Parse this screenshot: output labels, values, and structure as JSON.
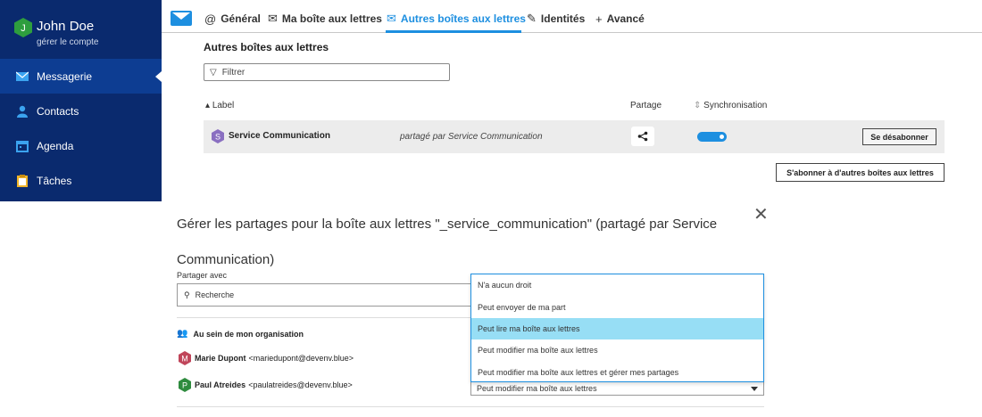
{
  "user": {
    "initial": "J",
    "name": "John Doe",
    "manage_label": "gérer le compte"
  },
  "sidebar": {
    "items": [
      {
        "label": "Messagerie",
        "icon": "mail-icon",
        "active": true
      },
      {
        "label": "Contacts",
        "icon": "person-icon"
      },
      {
        "label": "Agenda",
        "icon": "calendar-icon"
      },
      {
        "label": "Tâches",
        "icon": "clipboard-icon"
      }
    ]
  },
  "tabs": [
    {
      "label": "Général",
      "icon": "at-icon"
    },
    {
      "label": "Ma boîte aux lettres",
      "icon": "inbox-icon"
    },
    {
      "label": "Autres boîtes aux lettres",
      "icon": "mailboxes-icon",
      "active": true
    },
    {
      "label": "Identités",
      "icon": "signature-icon"
    },
    {
      "label": "Avancé",
      "icon": "plus-icon"
    }
  ],
  "mailboxes": {
    "title": "Autres boîtes aux lettres",
    "filter_placeholder": "Filtrer",
    "columns": {
      "label": "Label",
      "share": "Partage",
      "sync": "Synchronisation"
    },
    "rows": [
      {
        "initial": "S",
        "name": "Service Communication",
        "shared_by": "partagé par Service Communication",
        "sync_on": true,
        "unsubscribe_label": "Se désabonner"
      }
    ],
    "subscribe_label": "S'abonner à d'autres boîtes aux lettres"
  },
  "dialog": {
    "title": "Gérer les partages pour la boîte aux lettres \"_service_communication\" (partagé par Service Communication)",
    "share_with_label": "Partager avec",
    "search_placeholder": "Recherche",
    "org_heading": "Au sein de mon organisation",
    "people": [
      {
        "initial": "M",
        "name": "Marie Dupont",
        "email": "<mariedupont@devenv.blue>",
        "color": "#c0455a"
      },
      {
        "initial": "P",
        "name": "Paul Atreides",
        "email": "<paulatreides@devenv.blue>",
        "color": "#2e8b3e",
        "right": "Peut modifier ma boîte aux lettres"
      }
    ]
  },
  "dropdown": {
    "options": [
      "N'a aucun droit",
      "Peut envoyer de ma part",
      "Peut lire ma boîte aux lettres",
      "Peut modifier ma boîte aux lettres",
      "Peut modifier ma boîte aux lettres et gérer mes partages"
    ],
    "highlighted_index": 2
  },
  "colors": {
    "sidebar": "#0a2a6e",
    "accent": "#1d8fe0",
    "highlight": "#97def5"
  }
}
